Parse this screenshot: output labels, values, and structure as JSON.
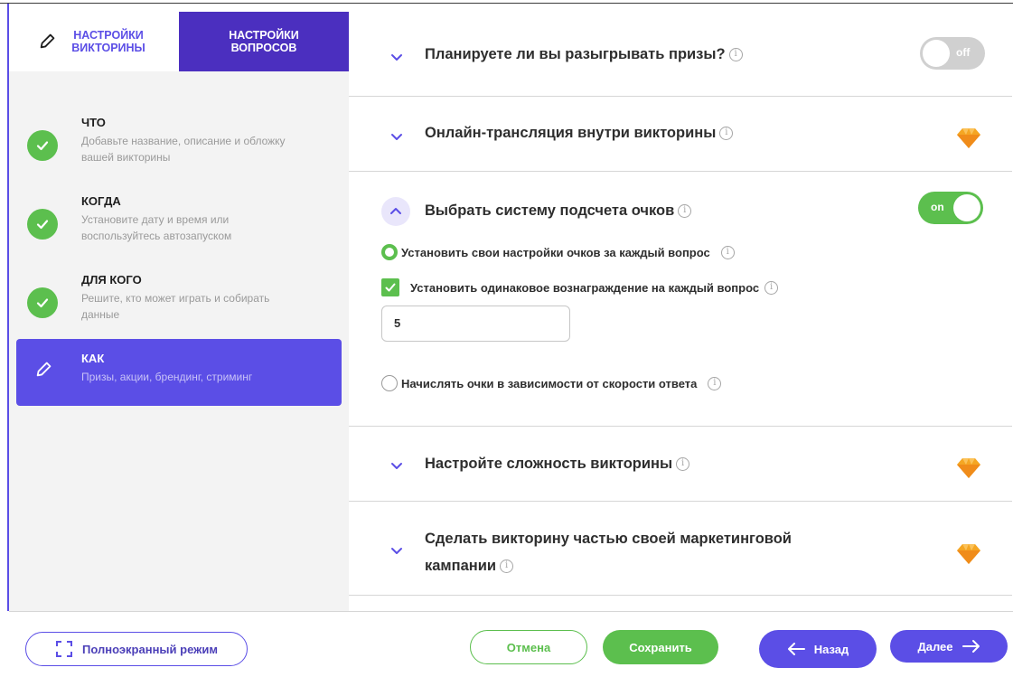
{
  "colors": {
    "accent": "#5b4ee6",
    "accent_dark": "#4b2fbf",
    "success": "#5cbf4e",
    "gem": "#f5a623"
  },
  "tabs": {
    "quiz_settings": "НАСТРОЙКИ ВИКТОРИНЫ",
    "question_settings": "НАСТРОЙКИ ВОПРОСОВ"
  },
  "steps": [
    {
      "title": "ЧТО",
      "desc": "Добавьте название, описание и обложку вашей викторины",
      "status": "done",
      "icon": "check-icon"
    },
    {
      "title": "КОГДА",
      "desc": "Установите дату и время или воспользуйтесь автозапуском",
      "status": "done",
      "icon": "check-icon"
    },
    {
      "title": "ДЛЯ КОГО",
      "desc": "Решите, кто может играть и собирать данные",
      "status": "done",
      "icon": "check-icon"
    },
    {
      "title": "КАК",
      "desc": "Призы, акции, брендинг, стриминг",
      "status": "active",
      "icon": "pencil-icon"
    }
  ],
  "sections": {
    "prizes": {
      "label": "Планируете ли вы разыгрывать призы?",
      "toggle": "off"
    },
    "streaming": {
      "label": "Онлайн-трансляция внутри викторины",
      "premium_icon": "gem-icon"
    },
    "scoring": {
      "label": "Выбрать систему подсчета очков",
      "toggle": "on",
      "option_custom": "Установить свои настройки очков за каждый вопрос",
      "option_same_reward": "Установить одинаковое вознаграждение на каждый вопрос",
      "reward_value": "5",
      "option_speed": "Начислять очки в зависимости от скорости ответа"
    },
    "difficulty": {
      "label": "Настройте сложность викторины",
      "premium_icon": "gem-icon"
    },
    "marketing": {
      "label_line1": "Сделать викторину частью своей маркетинговой",
      "label_line2": "кампании",
      "premium_icon": "gem-icon"
    }
  },
  "footer": {
    "fullscreen": "Полноэкранный режим",
    "cancel": "Отмена",
    "save": "Сохранить",
    "back": "Назад",
    "next": "Далее"
  }
}
